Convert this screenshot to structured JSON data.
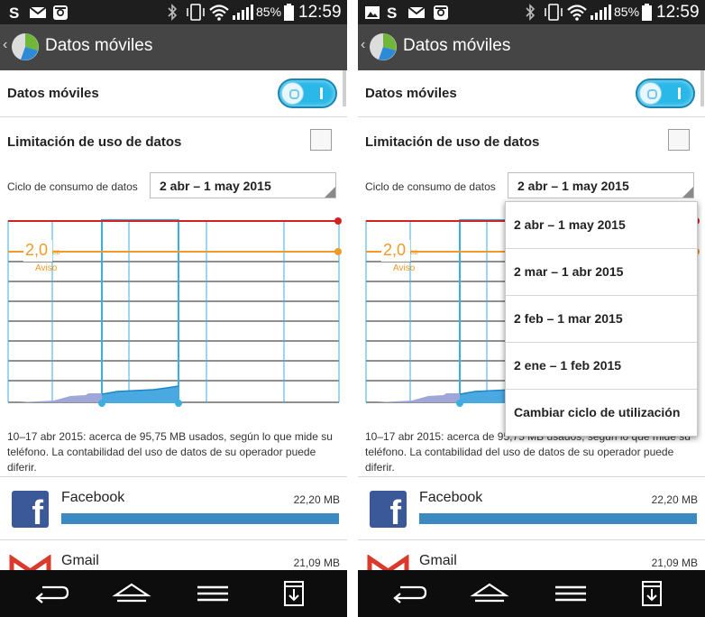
{
  "screens": [
    {
      "status": {
        "battery": "85%",
        "time": "12:59"
      },
      "title": "Datos móviles",
      "mobile_data_label": "Datos móviles",
      "mobile_data_on": true,
      "limit_label": "Limitación de uso de datos",
      "limit_checked": false,
      "cycle_label": "Ciclo de consumo de datos",
      "cycle_value": "2 abr – 1 may 2015",
      "chart": {
        "warning_value": "2,0",
        "warning_unit": "GB",
        "warning_label": "Aviso"
      },
      "note": "10–17 abr 2015: acerca de 95,75 MB usados, según lo que mide su teléfono. La contabilidad del uso de datos de su operador puede diferir.",
      "apps": [
        {
          "name": "Facebook",
          "size": "22,20 MB"
        },
        {
          "name": "Gmail",
          "size": "21,09 MB"
        }
      ]
    },
    {
      "status": {
        "battery": "85%",
        "time": "12:59"
      },
      "title": "Datos móviles",
      "mobile_data_label": "Datos móviles",
      "mobile_data_on": true,
      "limit_label": "Limitación de uso de datos",
      "limit_checked": false,
      "cycle_label": "Ciclo de consumo de datos",
      "cycle_value": "2 abr – 1 may 2015",
      "chart": {
        "warning_value": "2,0",
        "warning_unit": "GB",
        "warning_label": "Aviso"
      },
      "note": "10–17 abr 2015: acerca de 95,75 MB usados, según lo que mide su teléfono. La contabilidad del uso de datos de su operador puede diferir.",
      "apps": [
        {
          "name": "Facebook",
          "size": "22,20 MB"
        },
        {
          "name": "Gmail",
          "size": "21,09 MB"
        }
      ],
      "dropdown": {
        "options": [
          "2 abr – 1 may 2015",
          "2 mar – 1 abr 2015",
          "2 feb – 1 mar 2015",
          "2 ene – 1 feb 2015",
          "Cambiar ciclo de utilización"
        ]
      }
    }
  ],
  "colors": {
    "limit_line": "#d32222",
    "warning_line": "#f09a27",
    "grid_line": "#3aaee0",
    "usage_fill": "#4aa9e0",
    "usage_prev": "#9fa7d8",
    "accent": "#29b8e8"
  },
  "icons": {
    "status_left": [
      "skype-icon",
      "mail-icon",
      "instagram-icon"
    ],
    "status_left_right_phone": [
      "image-icon",
      "skype-icon",
      "mail-icon",
      "instagram-icon"
    ],
    "status_right": [
      "bluetooth-icon",
      "vibrate-icon",
      "wifi-icon",
      "signal-icon",
      "battery-icon"
    ],
    "nav": [
      "back-icon",
      "home-icon",
      "menu-icon",
      "download-icon"
    ]
  }
}
